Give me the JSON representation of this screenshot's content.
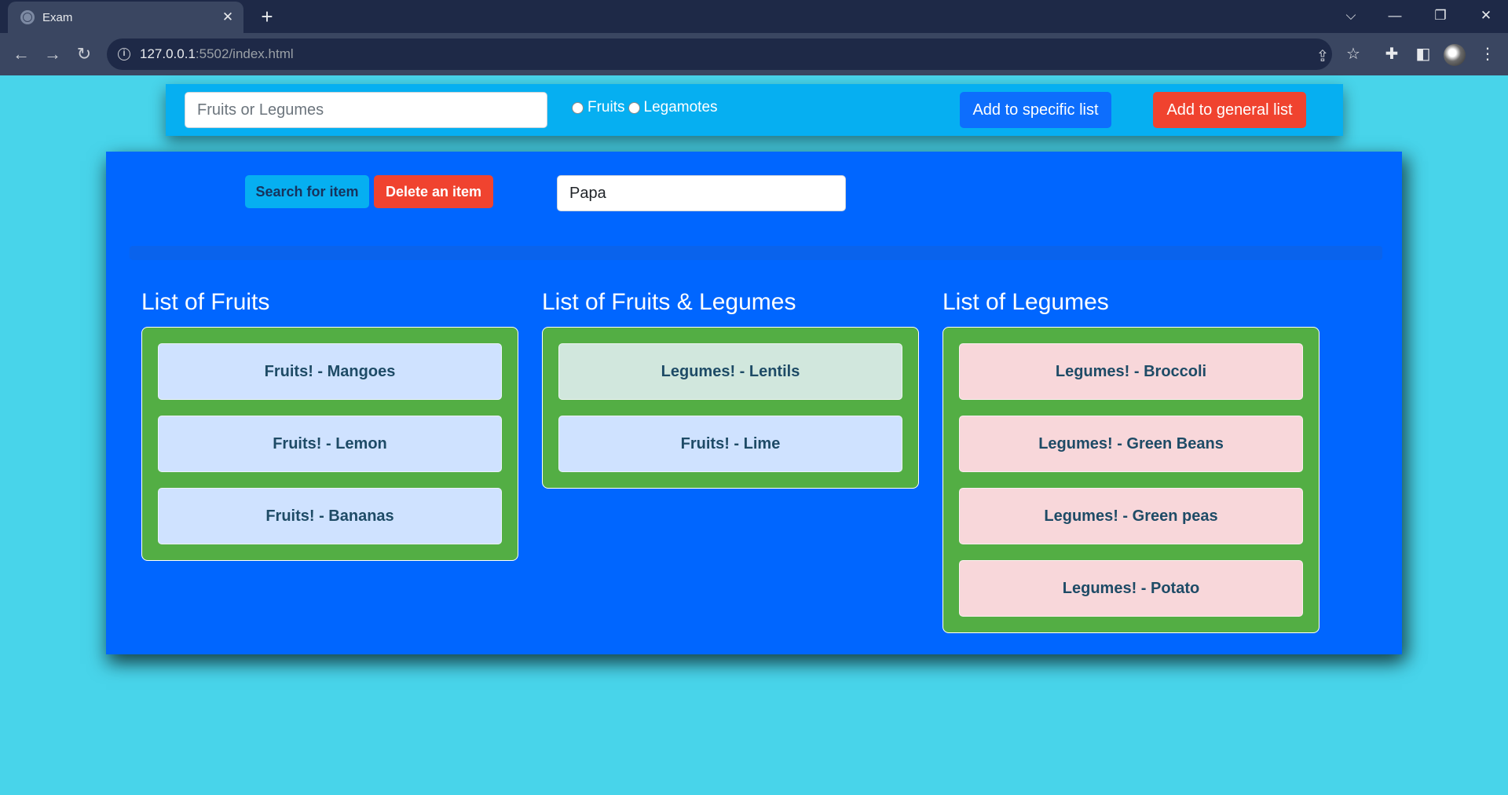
{
  "browser": {
    "tab_title": "Exam",
    "tab_close": "✕",
    "new_tab": "+",
    "url_host": "127.0.0.1",
    "url_path": ":5502/index.html",
    "back": "←",
    "forward": "→",
    "reload": "↻",
    "tab_list": "⌵",
    "minimize": "—",
    "restore": "❐",
    "close": "✕",
    "share": "⇪",
    "bookmark": "☆",
    "extensions": "✚",
    "sidebar": "◧",
    "menu": "⋮"
  },
  "topbar": {
    "input_placeholder": "Fruits or Legumes",
    "radio_fruits": "Fruits",
    "radio_legumes": "Legamotes",
    "add_specific": "Add to specific list",
    "add_general": "Add to general list"
  },
  "panel": {
    "search_button": "Search for item",
    "delete_button": "Delete an item",
    "search_value": "Papa"
  },
  "lists": {
    "fruits": {
      "title": "List of Fruits",
      "items": [
        "Fruits! - Mangoes",
        "Fruits! - Lemon",
        "Fruits! - Bananas"
      ]
    },
    "general": {
      "title": "List of Fruits & Legumes",
      "items": [
        "Legumes! - Lentils",
        "Fruits! - Lime"
      ]
    },
    "legumes": {
      "title": "List of Legumes",
      "items": [
        "Legumes! - Broccoli",
        "Legumes! - Green Beans",
        "Legumes! - Green peas",
        "Legumes! - Potato"
      ]
    }
  },
  "colors": {
    "page_bg": "#48d4ea",
    "topbar_bg": "#06aff1",
    "panel_bg": "#0066ff",
    "list_bg": "#53ae44",
    "fruit_item": "#cfe2ff",
    "mixed_legume_item": "#d1e7dd",
    "legume_item": "#f8d7da",
    "primary_button": "#0d6efd",
    "danger_button": "#f0432f"
  }
}
